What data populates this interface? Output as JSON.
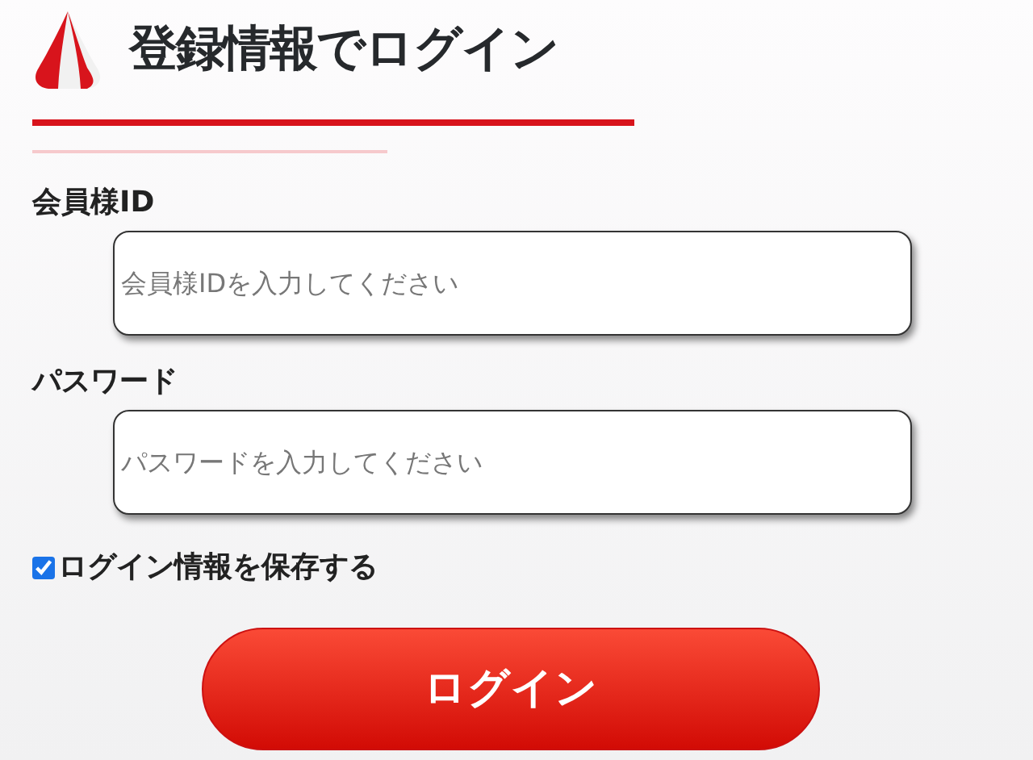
{
  "title": "登録情報でログイン",
  "fields": [
    {
      "label": "会員様ID",
      "placeholder": "会員様IDを入力してください"
    },
    {
      "label": "パスワード",
      "placeholder": "パスワードを入力してください"
    }
  ],
  "remember": {
    "label": "ログイン情報を保存する",
    "checked": true
  },
  "submit": "ログイン"
}
